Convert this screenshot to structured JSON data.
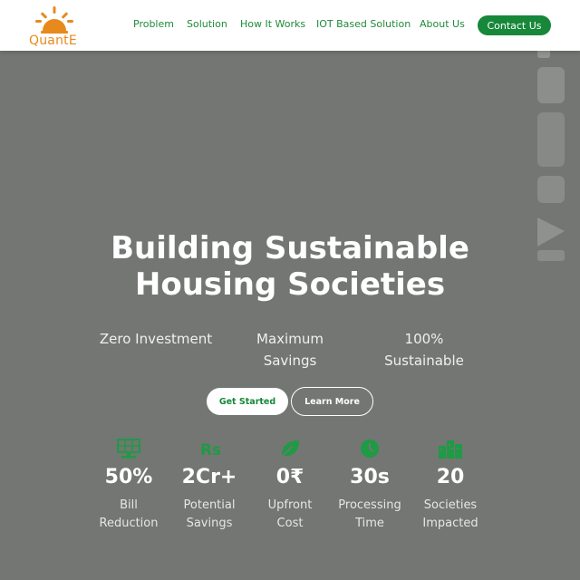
{
  "brand": {
    "name": "QuantE",
    "logo_icon": "sun-icon",
    "logo_color": "#e8891c"
  },
  "nav": {
    "items": [
      "Problem",
      "Solution",
      "How It Works",
      "IOT Based Solution",
      "About Us"
    ],
    "contact_label": "Contact Us"
  },
  "colors": {
    "accent": "#17873a",
    "hero_bg": "#737673"
  },
  "hero": {
    "title_line1": "Building Sustainable",
    "title_line2": "Housing Societies",
    "features": [
      {
        "line1": "Zero Investment",
        "line2": ""
      },
      {
        "line1": "Maximum",
        "line2": "Savings"
      },
      {
        "line1": "100%",
        "line2": "Sustainable"
      }
    ],
    "primary_button": "Get Started",
    "secondary_button": "Learn More"
  },
  "stats": [
    {
      "icon": "solar-panel-icon",
      "value": "50%",
      "label1": "Bill",
      "label2": "Reduction"
    },
    {
      "icon": "rupee-icon",
      "value": "2Cr+",
      "label1": "Potential",
      "label2": "Savings"
    },
    {
      "icon": "leaf-icon",
      "value": "0₹",
      "label1": "Upfront",
      "label2": "Cost"
    },
    {
      "icon": "clock-icon",
      "value": "30s",
      "label1": "Processing",
      "label2": "Time"
    },
    {
      "icon": "building-icon",
      "value": "20",
      "label1": "Societies",
      "label2": "Impacted"
    }
  ]
}
